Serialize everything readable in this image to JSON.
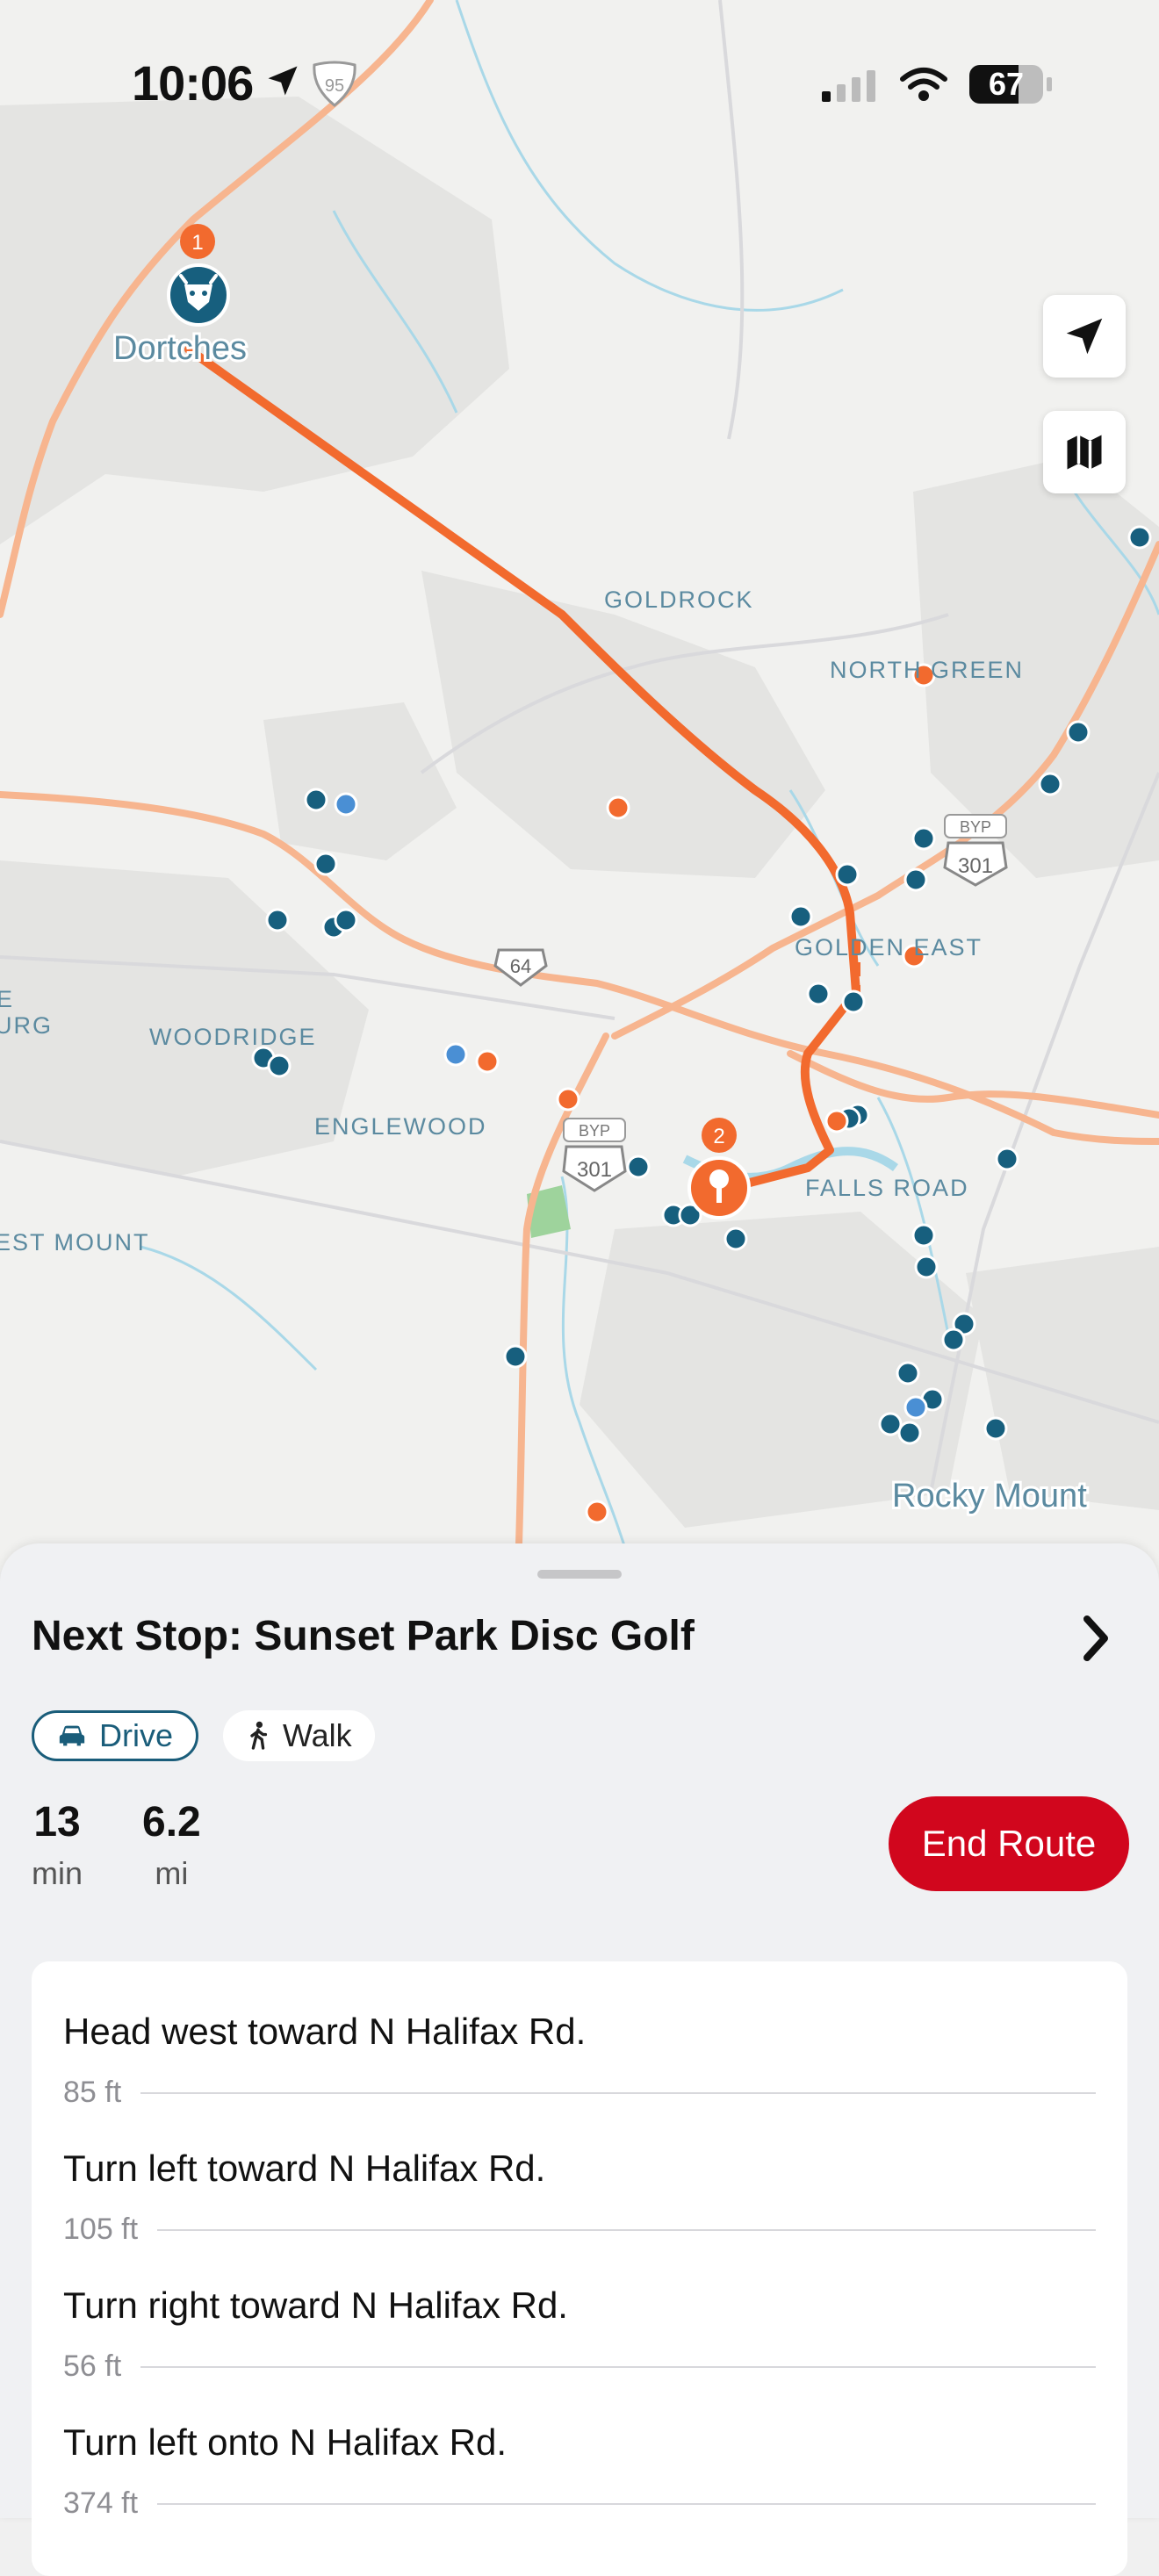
{
  "status_bar": {
    "time": "10:06",
    "battery": "67",
    "highway_badge": "95"
  },
  "map": {
    "places": [
      "Dortches",
      "GOLDROCK",
      "NORTH GREEN",
      "GOLDEN EAST",
      "WOODRIDGE",
      "ENGLEWOOD",
      "FALLS ROAD",
      "Rocky Mount",
      "EST MOUNT",
      "E",
      "URG"
    ],
    "route_shields": [
      "64",
      "301",
      "301"
    ],
    "byp_labels": [
      "BYP",
      "BYP"
    ],
    "stop_markers": [
      "1",
      "2"
    ],
    "colors": {
      "route": "#f26a2e",
      "poi_dark": "#175f7e",
      "poi_orange": "#f26a2e",
      "poi_blue": "#4a8fd4",
      "highway": "#f7b58f"
    }
  },
  "sheet": {
    "next_stop_title": "Next Stop: Sunset Park Disc Golf",
    "modes": [
      {
        "label": "Drive",
        "selected": true
      },
      {
        "label": "Walk",
        "selected": false
      }
    ],
    "stats": [
      {
        "value": "13",
        "unit": "min"
      },
      {
        "value": "6.2",
        "unit": "mi"
      }
    ],
    "end_route_label": "End Route",
    "steps": [
      {
        "instruction": "Head west toward N Halifax Rd.",
        "distance": "85 ft"
      },
      {
        "instruction": "Turn left toward N Halifax Rd.",
        "distance": "105 ft"
      },
      {
        "instruction": "Turn right toward N Halifax Rd.",
        "distance": "56 ft"
      },
      {
        "instruction": "Turn left onto N Halifax Rd.",
        "distance": "374 ft"
      }
    ]
  }
}
